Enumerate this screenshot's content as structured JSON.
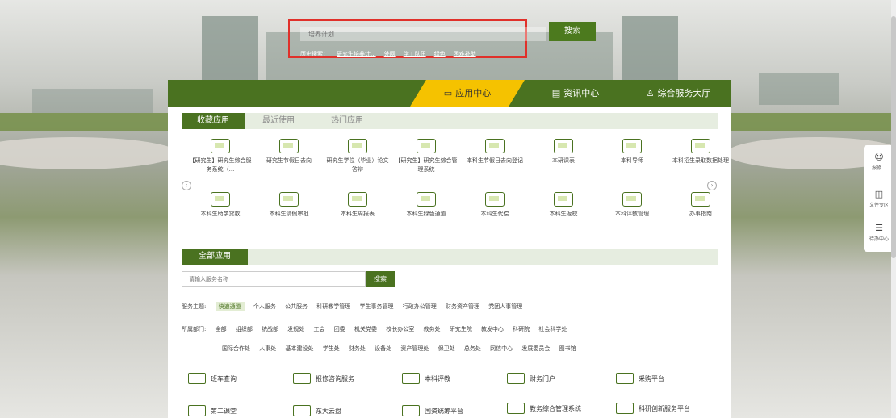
{
  "search": {
    "placeholder": "培养计划",
    "button": "搜索",
    "history": [
      "历史搜索：",
      "研究生培养计...",
      "外网",
      "学工队伍",
      "绿色",
      "困难补助"
    ]
  },
  "nav": {
    "tabs": [
      {
        "label": "应用中心",
        "icon": "monitor-icon"
      },
      {
        "label": "资讯中心",
        "icon": "doc-icon"
      },
      {
        "label": "综合服务大厅",
        "icon": "service-icon"
      }
    ]
  },
  "subtabs": [
    "收藏应用",
    "最近使用",
    "热门应用"
  ],
  "apps_row1": [
    "【研究生】研究生综合服务系统（...",
    "研究生节假日去向",
    "研究生学位（毕业）论文答辩",
    "【研究生】研究生综合管理系统",
    "本科生节假日去向登记",
    "本研课表",
    "本科导师",
    "本科招生录取数据处理"
  ],
  "apps_row2": [
    "本科生助学贷款",
    "本科生请假审批",
    "本科生周报表",
    "本科生绿色通道",
    "本科生代偿",
    "本科生返校",
    "本科评教管理",
    "办事指南"
  ],
  "all_apps": {
    "title": "全部应用",
    "search_placeholder": "请输入服务名称",
    "search_button": "搜索"
  },
  "filters": {
    "topic_label": "服务主题:",
    "topics": [
      "快速通道",
      "个人服务",
      "公共服务",
      "科研教学管理",
      "学生事务管理",
      "行政办公管理",
      "财务资产管理",
      "党团人事管理"
    ],
    "dept_label": "所属部门:",
    "depts1": [
      "全部",
      "组织部",
      "统战部",
      "发规处",
      "工会",
      "团委",
      "机关党委",
      "校长办公室",
      "教务处",
      "研究生院",
      "教发中心",
      "科研院",
      "社会科学处"
    ],
    "depts2": [
      "国际合作处",
      "人事处",
      "基本建设处",
      "学生处",
      "财务处",
      "设备处",
      "资产管理处",
      "保卫处",
      "总务处",
      "网信中心",
      "发展委员会",
      "图书馆"
    ]
  },
  "services": [
    "班车查询",
    "报修咨询服务",
    "本科评教",
    "财务门户",
    "采购平台",
    "第二课堂",
    "东大云盘",
    "国资统筹平台",
    "教务综合管理系统",
    "科研创新服务平台"
  ],
  "float": [
    "报修...",
    "文件专区",
    "待办中心"
  ]
}
